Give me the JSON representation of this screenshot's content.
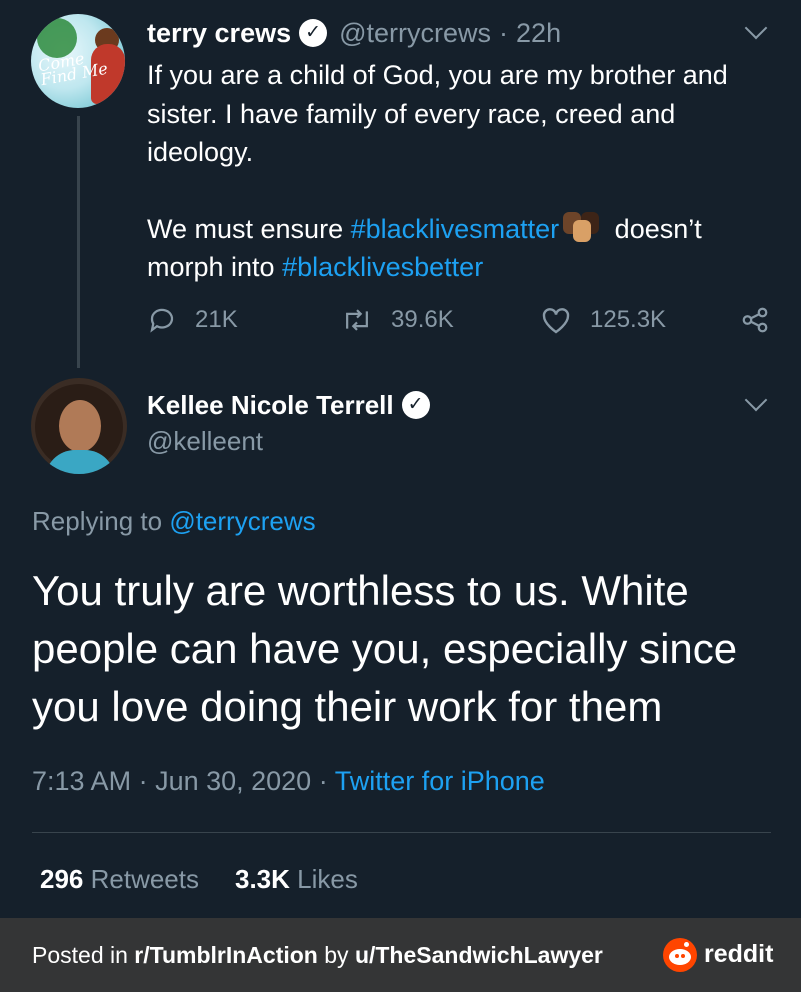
{
  "tweet1": {
    "display_name": "terry crews",
    "handle": "@terrycrews",
    "separator": "·",
    "time": "22h",
    "avatar_text": "Come Find Me",
    "text_line1": "If you are a child of God, you are my brother and sister. I have family of every race, creed and ideology.",
    "text_p2_a": "We must ensure ",
    "hashtag1": "#blacklivesmatter",
    "emoji": "fists",
    "text_p2_b": " doesn’t morph into ",
    "hashtag2": "#blacklivesbetter",
    "replies": "21K",
    "retweets": "39.6K",
    "likes": "125.3K"
  },
  "tweet2": {
    "display_name": "Kellee Nicole Terrell",
    "handle": "@kelleent",
    "replying_prefix": "Replying to ",
    "replying_to": "@terrycrews",
    "text": "You truly are worthless to us. White people can have you, especially since you love doing their work for them",
    "time": "7:13 AM",
    "sep1": " · ",
    "date": "Jun 30, 2020",
    "sep2": " · ",
    "source": "Twitter for iPhone",
    "retweet_count": "296",
    "retweet_label": " Retweets",
    "like_count": "3.3K",
    "like_label": " Likes"
  },
  "footer": {
    "posted_in": "Posted in ",
    "subreddit": "r/TumblrInAction",
    "by": " by ",
    "user": "u/TheSandwichLawyer",
    "brand": "reddit"
  },
  "colors": {
    "background": "#15202b",
    "link": "#1da1f2",
    "muted": "#8899a6",
    "footer_bg": "#343536",
    "reddit_orange": "#ff4500"
  }
}
